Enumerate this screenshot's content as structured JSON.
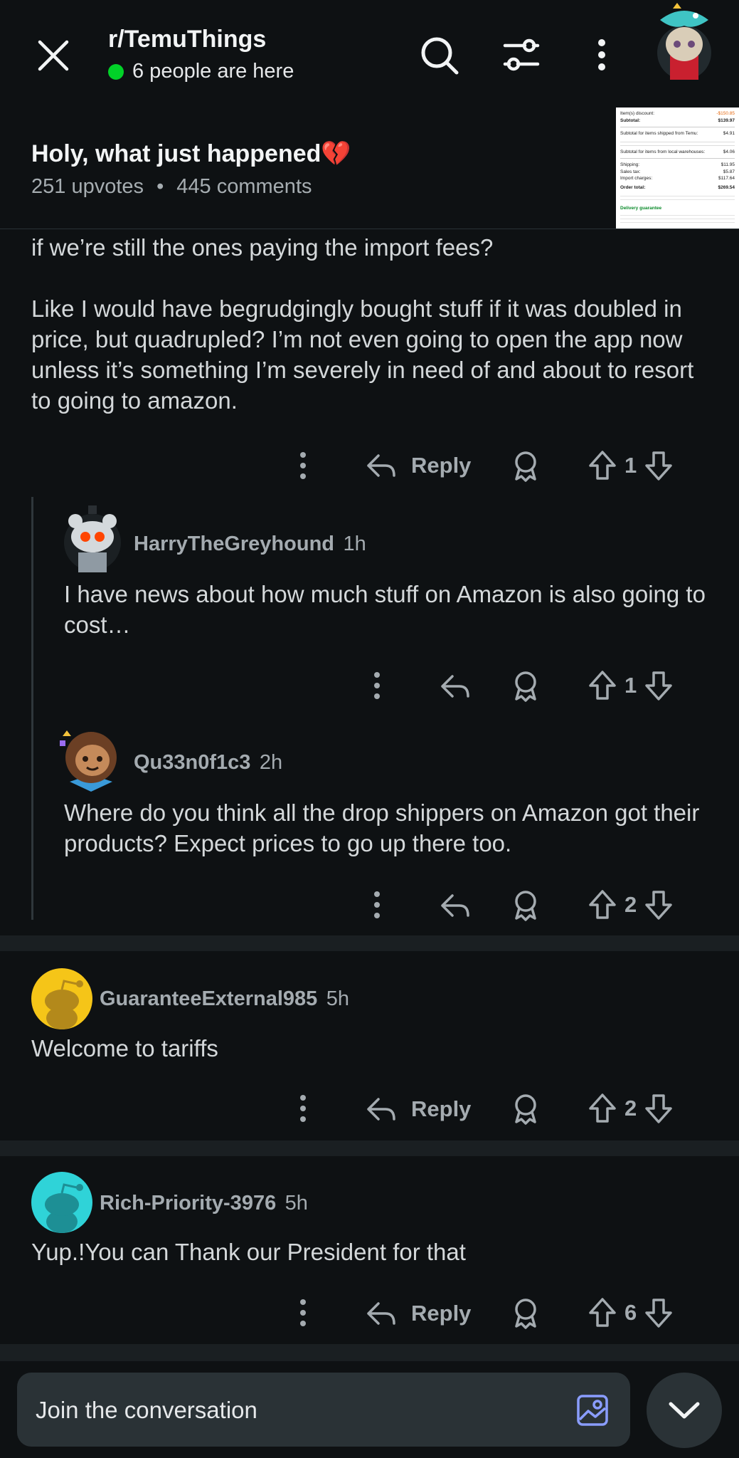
{
  "header": {
    "subreddit": "r/TemuThings",
    "presence": "6 people are here"
  },
  "post": {
    "title": "Holy, what just happened💔",
    "upvotes": "251 upvotes",
    "dot": "•",
    "comments": "445 comments"
  },
  "thumbnail": {
    "lines": [
      "Item(s) discount:",
      "Subtotal:",
      "Subtotal for items shipped from Temu:",
      "Subtotal for items from local warehouses:",
      "Shipping:",
      "Sales tax:",
      "Import charges:",
      "Order total:",
      "Delivery guarantee"
    ],
    "values": [
      "-$150.85",
      "$139.97",
      "$4.91",
      "$4.06",
      "$11.95",
      "$5.87",
      "$117.64",
      "$269.54"
    ]
  },
  "comments": [
    {
      "text": "if we’re still the ones paying the import fees?\n\nLike I would have begrudgingly bought stuff if it was doubled in price, but quadrupled? I’m not even going to open the app now unless it’s something I’m severely in need of and about to resort to going to amazon.",
      "reply": "Reply",
      "votes": "1"
    },
    {
      "author": "HarryTheGreyhound",
      "age": "1h",
      "text": "I have news about how much stuff on Amazon is also going to cost…",
      "votes": "1"
    },
    {
      "author": "Qu33n0f1c3",
      "age": "2h",
      "text": "Where do you think all the drop shippers on Amazon got their products? Expect prices to go up there too.",
      "votes": "2"
    },
    {
      "author": "GuaranteeExternal985",
      "age": "5h",
      "text": "Welcome to tariffs",
      "reply": "Reply",
      "votes": "2"
    },
    {
      "author": "Rich-Priority-3976",
      "age": "5h",
      "text": "Yup.!You can Thank our President for that",
      "reply": "Reply",
      "votes": "6"
    }
  ],
  "composer": {
    "placeholder": "Join the conversation"
  },
  "colors": {
    "background": "#0e1113",
    "online": "#01d228",
    "accent_icon": "#8a9dff"
  }
}
